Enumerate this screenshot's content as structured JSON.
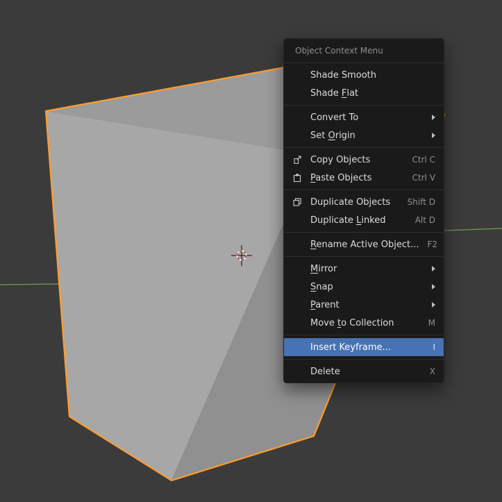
{
  "scene": {
    "colors": {
      "background": "#3b3b3b",
      "cube_top": "#9b9b9b",
      "cube_front": "#a7a7a7",
      "cube_right": "#909090",
      "selection_outline": "#ff9d2e",
      "axis_y_green": "#6f9e4f",
      "highlight_blue": "#4772b3"
    }
  },
  "menu": {
    "title": "Object Context Menu",
    "items": [
      {
        "pre": "Shade Smooth"
      },
      {
        "pre": "Shade ",
        "key": "F",
        "post": "lat"
      },
      {
        "pre": "Convert To"
      },
      {
        "pre": "Set ",
        "key": "O",
        "post": "rigin"
      },
      {
        "pre": "Copy Objects",
        "shortcut": "Ctrl C"
      },
      {
        "key": "P",
        "post": "aste Objects",
        "shortcut": "Ctrl V"
      },
      {
        "pre": "Duplicate Objects",
        "shortcut": "Shift D"
      },
      {
        "pre": "Duplicate ",
        "key": "L",
        "post": "inked",
        "shortcut": "Alt D"
      },
      {
        "key": "R",
        "post": "ename Active Object...",
        "shortcut": "F2"
      },
      {
        "key": "M",
        "post": "irror"
      },
      {
        "key": "S",
        "post": "nap"
      },
      {
        "key": "P",
        "post": "arent"
      },
      {
        "pre": "Move ",
        "key": "t",
        "post": "o Collection",
        "shortcut": "M"
      },
      {
        "pre": "Insert Keyframe...",
        "shortcut": "I"
      },
      {
        "pre": "Delete",
        "shortcut": "X"
      }
    ]
  }
}
